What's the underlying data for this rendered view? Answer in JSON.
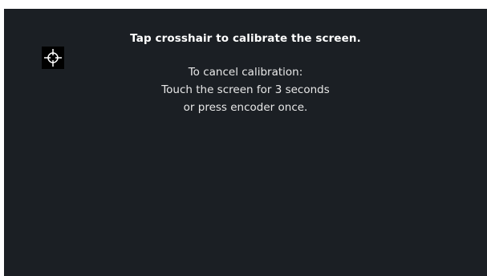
{
  "calibration": {
    "title": "Tap crosshair to calibrate the screen.",
    "instructions": [
      "To cancel calibration:",
      "Touch the screen for 3 seconds",
      "or press encoder once."
    ],
    "target_icon": "crosshair-icon"
  },
  "colors": {
    "screen_background": "#1b1f24",
    "text": "#ffffff",
    "target_background": "#000000"
  }
}
